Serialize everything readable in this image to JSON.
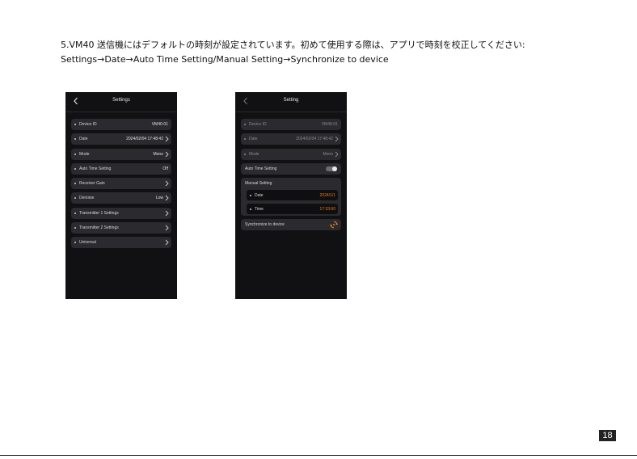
{
  "instruction": {
    "line1": "5.VM40 送信機にはデフォルトの時刻が設定されています。初めて使用する際は、アプリで時刻を校正してください:",
    "line2": "Settings→Date→Auto Time Setting/Manual Setting→Synchronize to device"
  },
  "left_screen": {
    "title": "Settings",
    "rows": [
      {
        "label": "Device ID",
        "value": "VM40-01"
      },
      {
        "label": "Date",
        "value": "2024/02/04  17:48:42"
      },
      {
        "label": "Mode",
        "value": "Mono"
      },
      {
        "label": "Auto Time Setting",
        "value": "Off"
      },
      {
        "label": "Receiver Gain",
        "value": ""
      },
      {
        "label": "Denoise",
        "value": "Low"
      },
      {
        "label": "Transmitter 1 Settings",
        "value": ""
      },
      {
        "label": "Transmitter 2 Settings",
        "value": ""
      },
      {
        "label": "Universal",
        "value": ""
      }
    ]
  },
  "right_screen": {
    "title": "Setting",
    "rows": [
      {
        "label": "Device ID",
        "value": "VM40-01"
      },
      {
        "label": "Date",
        "value": "2024/02/04  17:48:42"
      },
      {
        "label": "Mode",
        "value": "Mono"
      }
    ],
    "auto_time_label": "Auto Time Setting",
    "manual_setting": {
      "title": "Manual Setting",
      "date_label": "Date",
      "date_value": "2024/1/1",
      "time_label": "Time",
      "time_value": "17:33:60"
    },
    "sync_label": "Synchronize to device"
  },
  "colors": {
    "accent": "#e67a1e",
    "screen_bg": "#111113",
    "row_bg": "#2b2b2f"
  },
  "page_number": "18"
}
